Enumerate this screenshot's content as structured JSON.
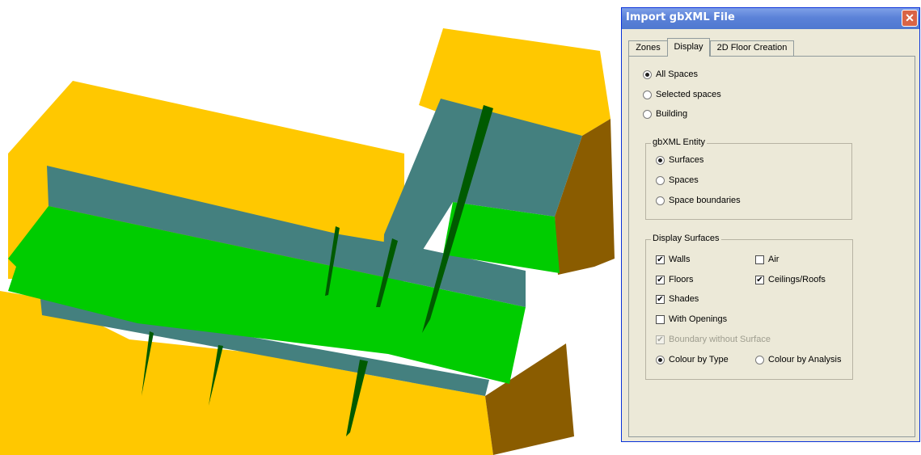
{
  "dialog": {
    "title": "Import gbXML File",
    "close_glyph": "✕",
    "tabs": [
      {
        "label": "Zones"
      },
      {
        "label": "Display"
      },
      {
        "label": "2D Floor Creation"
      }
    ],
    "active_tab": "Display",
    "display_scope": {
      "options": [
        {
          "label": "All Spaces",
          "selected": true
        },
        {
          "label": "Selected spaces",
          "selected": false
        },
        {
          "label": "Building",
          "selected": false
        }
      ]
    },
    "entity_group": {
      "title": "gbXML Entity",
      "options": [
        {
          "label": "Surfaces",
          "selected": true
        },
        {
          "label": "Spaces",
          "selected": false
        },
        {
          "label": "Space boundaries",
          "selected": false
        }
      ]
    },
    "surfaces_group": {
      "title": "Display Surfaces",
      "walls": {
        "label": "Walls",
        "checked": true
      },
      "air": {
        "label": "Air",
        "checked": false
      },
      "floors": {
        "label": "Floors",
        "checked": true
      },
      "ceilings_roofs": {
        "label": "Ceilings/Roofs",
        "checked": true
      },
      "shades": {
        "label": "Shades",
        "checked": true
      },
      "with_openings": {
        "label": "With Openings",
        "checked": false
      },
      "boundary_without_surface": {
        "label": "Boundary without Surface",
        "checked": true,
        "enabled": false
      },
      "colour_by_type": {
        "label": "Colour by Type",
        "selected": true
      },
      "colour_by_analysis": {
        "label": "Colour by Analysis",
        "selected": false
      }
    }
  },
  "model_colors": {
    "wall": "#ffc800",
    "wall_dark": "#8a5c00",
    "ceiling": "#44807f",
    "floor": "#00cc00",
    "floor_dark": "#005a00"
  }
}
